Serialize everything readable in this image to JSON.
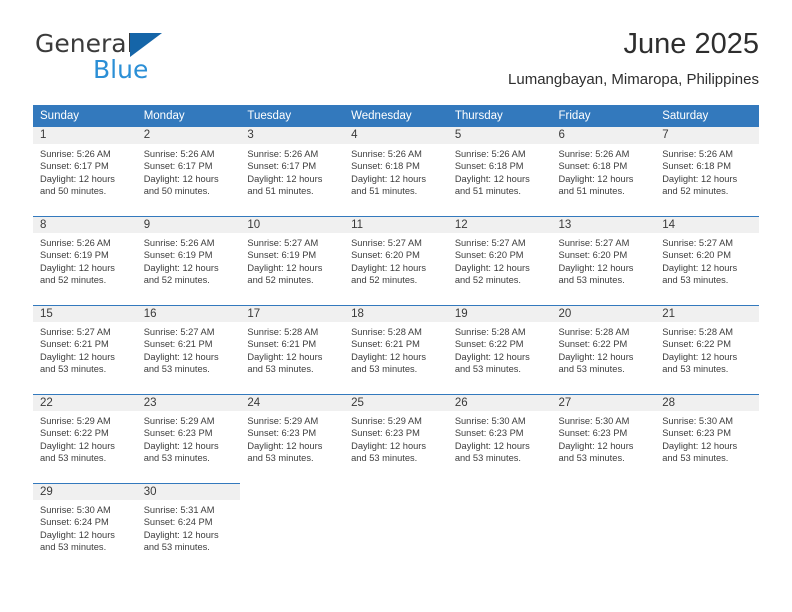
{
  "brand": {
    "name_part1": "General",
    "name_part2": "Blue",
    "triangle_color": "#1565a8",
    "blue_color": "#2b8fd6"
  },
  "header": {
    "title": "June 2025",
    "subtitle": "Lumangbayan, Mimaropa, Philippines"
  },
  "theme": {
    "header_bg": "#3379bd",
    "daynum_bg": "#f0f0f0",
    "rule_color": "#3379bd",
    "text_color": "#3d3d3d"
  },
  "weekdays": [
    "Sunday",
    "Monday",
    "Tuesday",
    "Wednesday",
    "Thursday",
    "Friday",
    "Saturday"
  ],
  "weeks": [
    [
      {
        "day": "1",
        "sunrise": "Sunrise: 5:26 AM",
        "sunset": "Sunset: 6:17 PM",
        "daylight1": "Daylight: 12 hours",
        "daylight2": "and 50 minutes."
      },
      {
        "day": "2",
        "sunrise": "Sunrise: 5:26 AM",
        "sunset": "Sunset: 6:17 PM",
        "daylight1": "Daylight: 12 hours",
        "daylight2": "and 50 minutes."
      },
      {
        "day": "3",
        "sunrise": "Sunrise: 5:26 AM",
        "sunset": "Sunset: 6:17 PM",
        "daylight1": "Daylight: 12 hours",
        "daylight2": "and 51 minutes."
      },
      {
        "day": "4",
        "sunrise": "Sunrise: 5:26 AM",
        "sunset": "Sunset: 6:18 PM",
        "daylight1": "Daylight: 12 hours",
        "daylight2": "and 51 minutes."
      },
      {
        "day": "5",
        "sunrise": "Sunrise: 5:26 AM",
        "sunset": "Sunset: 6:18 PM",
        "daylight1": "Daylight: 12 hours",
        "daylight2": "and 51 minutes."
      },
      {
        "day": "6",
        "sunrise": "Sunrise: 5:26 AM",
        "sunset": "Sunset: 6:18 PM",
        "daylight1": "Daylight: 12 hours",
        "daylight2": "and 51 minutes."
      },
      {
        "day": "7",
        "sunrise": "Sunrise: 5:26 AM",
        "sunset": "Sunset: 6:18 PM",
        "daylight1": "Daylight: 12 hours",
        "daylight2": "and 52 minutes."
      }
    ],
    [
      {
        "day": "8",
        "sunrise": "Sunrise: 5:26 AM",
        "sunset": "Sunset: 6:19 PM",
        "daylight1": "Daylight: 12 hours",
        "daylight2": "and 52 minutes."
      },
      {
        "day": "9",
        "sunrise": "Sunrise: 5:26 AM",
        "sunset": "Sunset: 6:19 PM",
        "daylight1": "Daylight: 12 hours",
        "daylight2": "and 52 minutes."
      },
      {
        "day": "10",
        "sunrise": "Sunrise: 5:27 AM",
        "sunset": "Sunset: 6:19 PM",
        "daylight1": "Daylight: 12 hours",
        "daylight2": "and 52 minutes."
      },
      {
        "day": "11",
        "sunrise": "Sunrise: 5:27 AM",
        "sunset": "Sunset: 6:20 PM",
        "daylight1": "Daylight: 12 hours",
        "daylight2": "and 52 minutes."
      },
      {
        "day": "12",
        "sunrise": "Sunrise: 5:27 AM",
        "sunset": "Sunset: 6:20 PM",
        "daylight1": "Daylight: 12 hours",
        "daylight2": "and 52 minutes."
      },
      {
        "day": "13",
        "sunrise": "Sunrise: 5:27 AM",
        "sunset": "Sunset: 6:20 PM",
        "daylight1": "Daylight: 12 hours",
        "daylight2": "and 53 minutes."
      },
      {
        "day": "14",
        "sunrise": "Sunrise: 5:27 AM",
        "sunset": "Sunset: 6:20 PM",
        "daylight1": "Daylight: 12 hours",
        "daylight2": "and 53 minutes."
      }
    ],
    [
      {
        "day": "15",
        "sunrise": "Sunrise: 5:27 AM",
        "sunset": "Sunset: 6:21 PM",
        "daylight1": "Daylight: 12 hours",
        "daylight2": "and 53 minutes."
      },
      {
        "day": "16",
        "sunrise": "Sunrise: 5:27 AM",
        "sunset": "Sunset: 6:21 PM",
        "daylight1": "Daylight: 12 hours",
        "daylight2": "and 53 minutes."
      },
      {
        "day": "17",
        "sunrise": "Sunrise: 5:28 AM",
        "sunset": "Sunset: 6:21 PM",
        "daylight1": "Daylight: 12 hours",
        "daylight2": "and 53 minutes."
      },
      {
        "day": "18",
        "sunrise": "Sunrise: 5:28 AM",
        "sunset": "Sunset: 6:21 PM",
        "daylight1": "Daylight: 12 hours",
        "daylight2": "and 53 minutes."
      },
      {
        "day": "19",
        "sunrise": "Sunrise: 5:28 AM",
        "sunset": "Sunset: 6:22 PM",
        "daylight1": "Daylight: 12 hours",
        "daylight2": "and 53 minutes."
      },
      {
        "day": "20",
        "sunrise": "Sunrise: 5:28 AM",
        "sunset": "Sunset: 6:22 PM",
        "daylight1": "Daylight: 12 hours",
        "daylight2": "and 53 minutes."
      },
      {
        "day": "21",
        "sunrise": "Sunrise: 5:28 AM",
        "sunset": "Sunset: 6:22 PM",
        "daylight1": "Daylight: 12 hours",
        "daylight2": "and 53 minutes."
      }
    ],
    [
      {
        "day": "22",
        "sunrise": "Sunrise: 5:29 AM",
        "sunset": "Sunset: 6:22 PM",
        "daylight1": "Daylight: 12 hours",
        "daylight2": "and 53 minutes."
      },
      {
        "day": "23",
        "sunrise": "Sunrise: 5:29 AM",
        "sunset": "Sunset: 6:23 PM",
        "daylight1": "Daylight: 12 hours",
        "daylight2": "and 53 minutes."
      },
      {
        "day": "24",
        "sunrise": "Sunrise: 5:29 AM",
        "sunset": "Sunset: 6:23 PM",
        "daylight1": "Daylight: 12 hours",
        "daylight2": "and 53 minutes."
      },
      {
        "day": "25",
        "sunrise": "Sunrise: 5:29 AM",
        "sunset": "Sunset: 6:23 PM",
        "daylight1": "Daylight: 12 hours",
        "daylight2": "and 53 minutes."
      },
      {
        "day": "26",
        "sunrise": "Sunrise: 5:30 AM",
        "sunset": "Sunset: 6:23 PM",
        "daylight1": "Daylight: 12 hours",
        "daylight2": "and 53 minutes."
      },
      {
        "day": "27",
        "sunrise": "Sunrise: 5:30 AM",
        "sunset": "Sunset: 6:23 PM",
        "daylight1": "Daylight: 12 hours",
        "daylight2": "and 53 minutes."
      },
      {
        "day": "28",
        "sunrise": "Sunrise: 5:30 AM",
        "sunset": "Sunset: 6:23 PM",
        "daylight1": "Daylight: 12 hours",
        "daylight2": "and 53 minutes."
      }
    ],
    [
      {
        "day": "29",
        "sunrise": "Sunrise: 5:30 AM",
        "sunset": "Sunset: 6:24 PM",
        "daylight1": "Daylight: 12 hours",
        "daylight2": "and 53 minutes."
      },
      {
        "day": "30",
        "sunrise": "Sunrise: 5:31 AM",
        "sunset": "Sunset: 6:24 PM",
        "daylight1": "Daylight: 12 hours",
        "daylight2": "and 53 minutes."
      },
      {
        "day": "",
        "sunrise": "",
        "sunset": "",
        "daylight1": "",
        "daylight2": ""
      },
      {
        "day": "",
        "sunrise": "",
        "sunset": "",
        "daylight1": "",
        "daylight2": ""
      },
      {
        "day": "",
        "sunrise": "",
        "sunset": "",
        "daylight1": "",
        "daylight2": ""
      },
      {
        "day": "",
        "sunrise": "",
        "sunset": "",
        "daylight1": "",
        "daylight2": ""
      },
      {
        "day": "",
        "sunrise": "",
        "sunset": "",
        "daylight1": "",
        "daylight2": ""
      }
    ]
  ]
}
